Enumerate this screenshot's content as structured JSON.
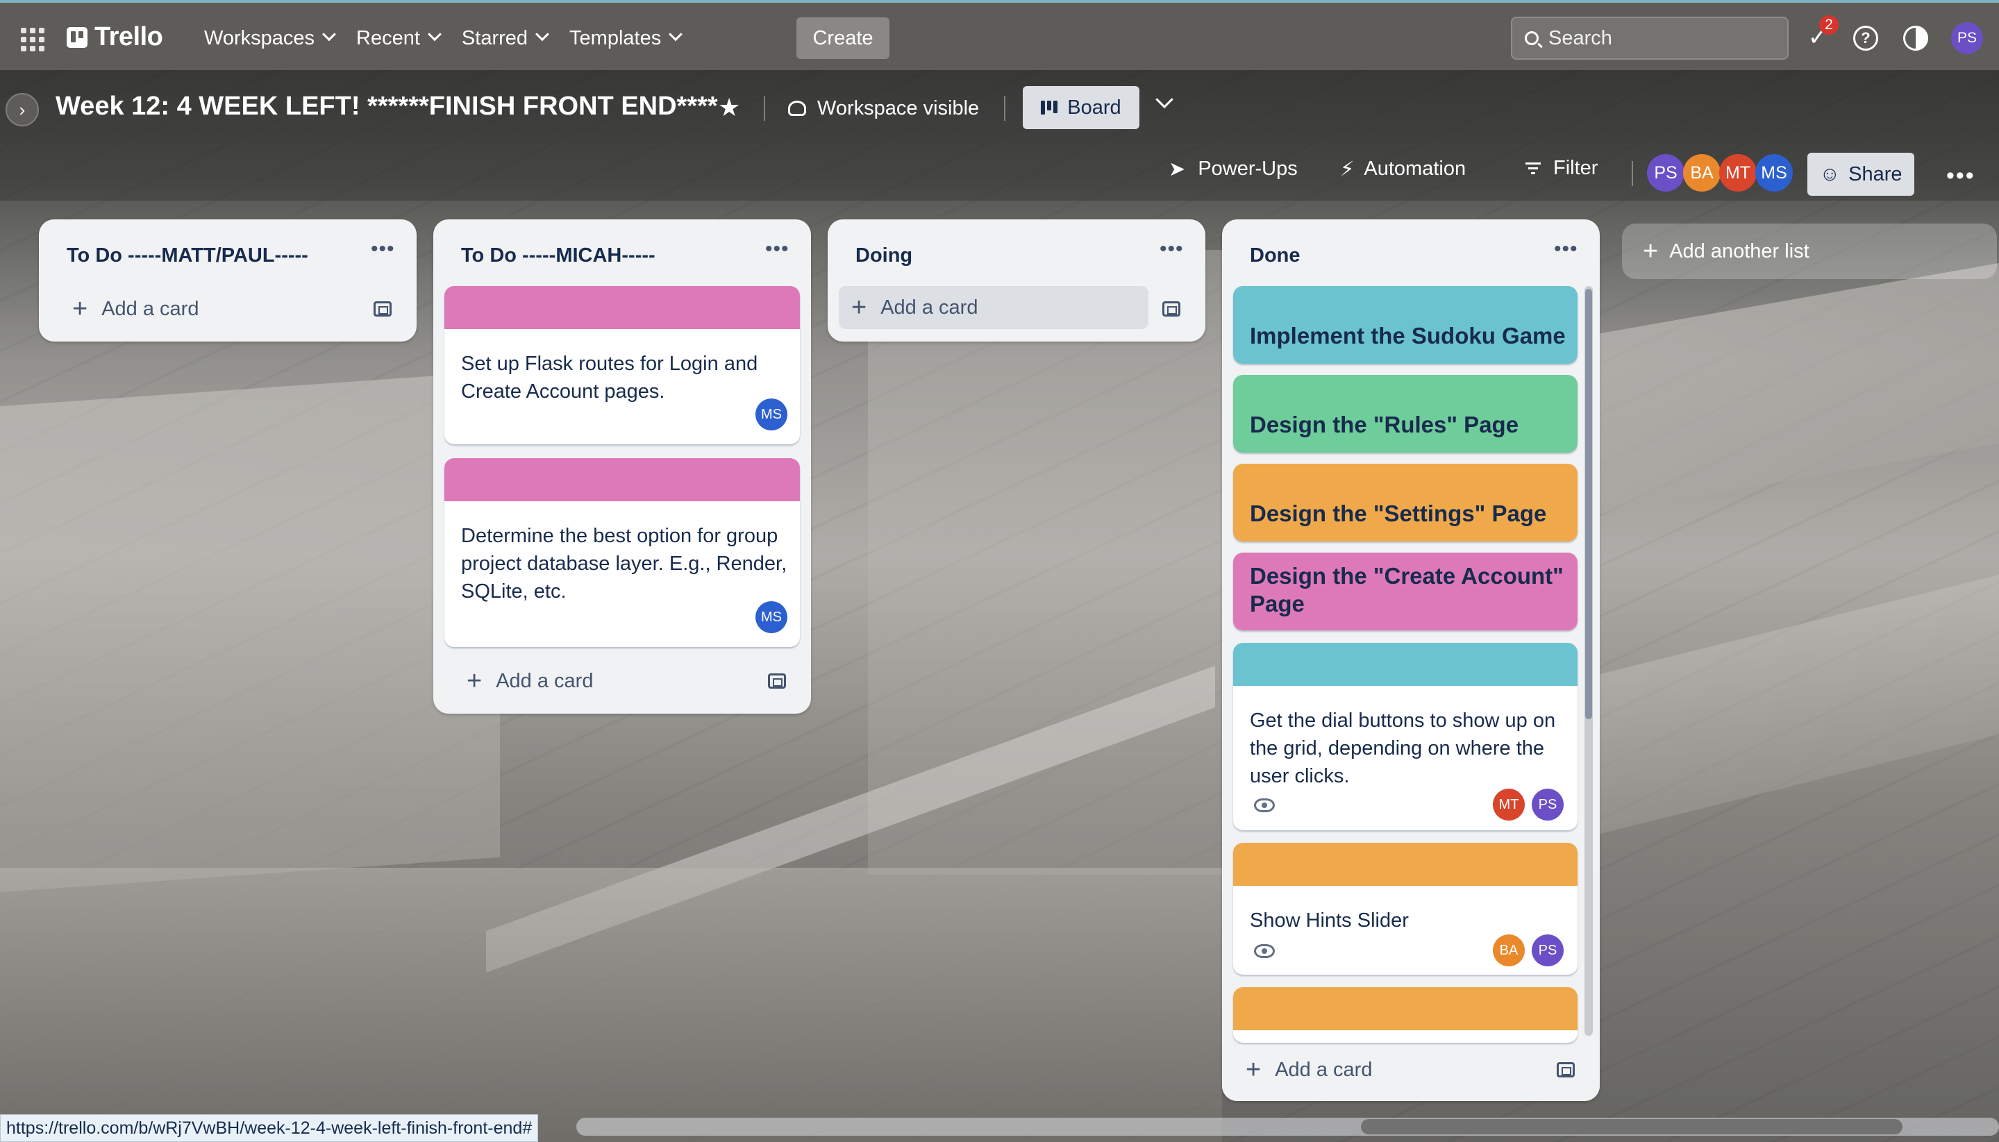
{
  "nav": {
    "logo": "Trello",
    "menu": [
      {
        "label": "Workspaces"
      },
      {
        "label": "Recent"
      },
      {
        "label": "Starred"
      },
      {
        "label": "Templates"
      }
    ],
    "create_label": "Create",
    "search_placeholder": "Search",
    "notifications_count": "2",
    "user_initials": "PS"
  },
  "board": {
    "title": "Week 12: 4 WEEK LEFT! ******FINISH FRONT END****",
    "visibility": "Workspace visible",
    "view": "Board",
    "powerups": "Power-Ups",
    "automation": "Automation",
    "filter": "Filter",
    "share": "Share",
    "members": [
      {
        "initials": "PS",
        "color": "#6b4fc7"
      },
      {
        "initials": "BA",
        "color": "#e9892b"
      },
      {
        "initials": "MT",
        "color": "#d9452b"
      },
      {
        "initials": "MS",
        "color": "#2c5fcf"
      }
    ],
    "add_list": "Add another list"
  },
  "add_card_label": "Add a card",
  "lists": [
    {
      "title": "To Do -----MATT/PAUL-----",
      "cards": []
    },
    {
      "title": "To Do -----MICAH-----",
      "cards": [
        {
          "cover": "#de79b9",
          "text": "Set up Flask routes for Login and Create Account pages.",
          "members": [
            "MS"
          ]
        },
        {
          "cover": "#de79b9",
          "text": "Determine the best option for group project database layer. E.g., Render, SQLite, etc.",
          "members": [
            "MS"
          ]
        }
      ]
    },
    {
      "title": "Doing",
      "cards": []
    },
    {
      "title": "Done",
      "cards": [
        {
          "cover": "#6cc3d0",
          "text": "Implement the Sudoku Game",
          "full_cover": true
        },
        {
          "cover": "#6fcc9b",
          "text": "Design the \"Rules\" Page",
          "full_cover": true
        },
        {
          "cover": "#f0a94a",
          "text": "Design the \"Settings\" Page",
          "full_cover": true
        },
        {
          "cover": "#de79b9",
          "text": "Design the \"Create Account\" Page",
          "full_cover": true
        },
        {
          "cover": "#6cc3d0",
          "text": "Get the dial buttons to show up on the grid, depending on where the user clicks.",
          "members": [
            "MT",
            "PS"
          ],
          "watching": true
        },
        {
          "cover": "#f0a94a",
          "text": "Show Hints Slider",
          "members": [
            "BA",
            "PS"
          ],
          "watching": true
        },
        {
          "cover": "#f0a94a",
          "text": ""
        }
      ]
    }
  ],
  "status_url": "https://trello.com/b/wRj7VwBH/week-12-4-week-left-finish-front-end#",
  "colors": {
    "nav_bg": "#5e5c58",
    "list_bg": "#f1f2f4",
    "pink": "#de79b9",
    "teal": "#6cc3d0",
    "green": "#6fcc9b",
    "orange": "#f0a94a"
  }
}
